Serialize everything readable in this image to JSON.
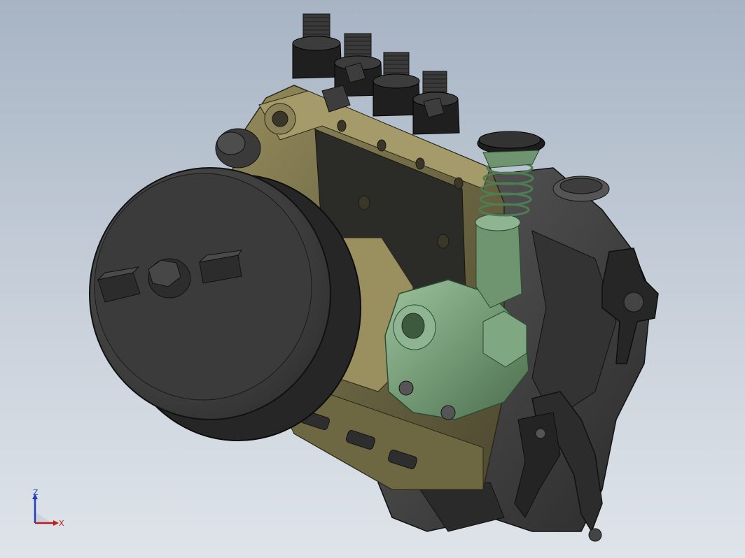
{
  "viewport": {
    "background_top": "#a7b4c4",
    "background_bottom": "#dfe4ea",
    "model_colors": {
      "housing": "#5b5637",
      "housing_light": "#857c50",
      "dark_parts": "#3a3a3a",
      "black_parts": "#1e1e1e",
      "highlighted_part": "#6e9470"
    }
  },
  "triad": {
    "z_label": "Z",
    "x_label": "X",
    "z_color": "#1f3fbf",
    "x_color": "#c21b1b"
  }
}
